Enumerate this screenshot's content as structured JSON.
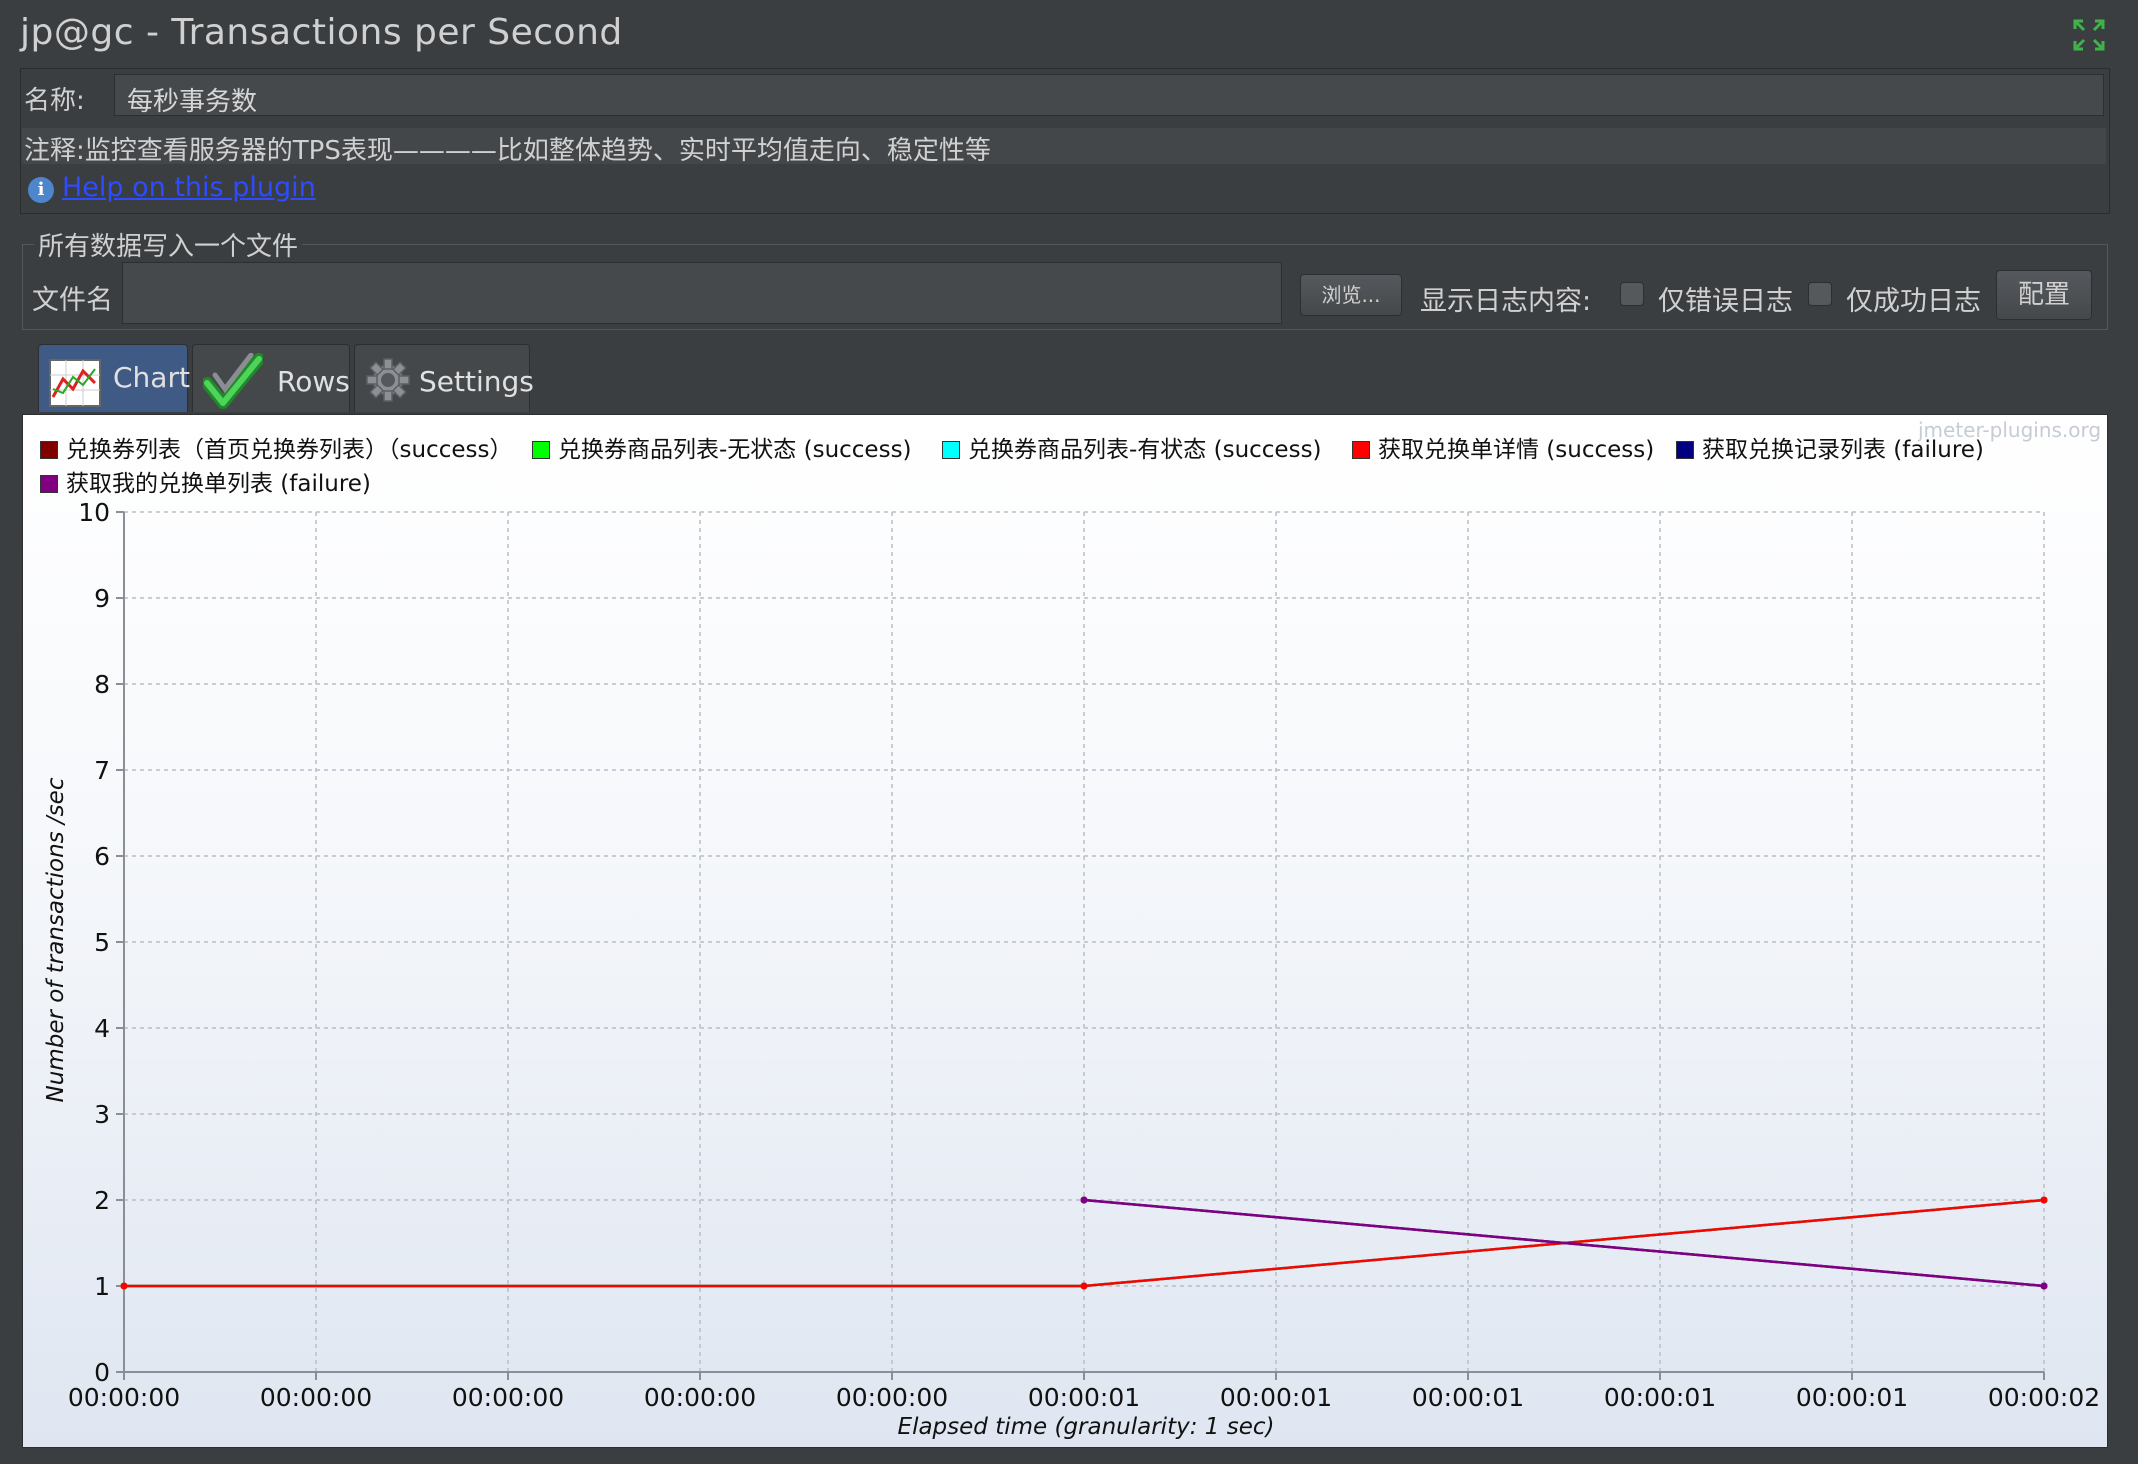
{
  "window": {
    "title": "jp@gc - Transactions per Second"
  },
  "form": {
    "name_label": "名称:",
    "name_value": "每秒事务数",
    "comment_label": "注释:",
    "comment_value": "监控查看服务器的TPS表现————比如整体趋势、实时平均值走向、稳定性等",
    "help_link": "Help on this plugin"
  },
  "file_panel": {
    "legend": "所有数据写入一个文件",
    "file_label": "文件名",
    "file_value": "",
    "browse_button": "浏览...",
    "log_label": "显示日志内容:",
    "errors_only": {
      "label": "仅错误日志",
      "checked": false
    },
    "success_only": {
      "label": "仅成功日志",
      "checked": false
    },
    "config_button": "配置"
  },
  "tabs": [
    {
      "label": "Chart",
      "icon": "chart-icon",
      "active": true
    },
    {
      "label": "Rows",
      "icon": "checkmark-icon",
      "active": false
    },
    {
      "label": "Settings",
      "icon": "gear-icon",
      "active": false
    }
  ],
  "chart": {
    "watermark": "jmeter-plugins.org"
  },
  "chart_data": {
    "type": "line",
    "xlabel": "Elapsed time (granularity: 1 sec)",
    "ylabel": "Number of transactions /sec",
    "ylim": [
      0,
      10
    ],
    "yticks": [
      "0",
      "1",
      "2",
      "3",
      "4",
      "5",
      "6",
      "7",
      "8",
      "9",
      "10"
    ],
    "x_tick_labels": [
      "00:00:00",
      "00:00:00",
      "00:00:00",
      "00:00:00",
      "00:00:00",
      "00:00:01",
      "00:00:01",
      "00:00:01",
      "00:00:01",
      "00:00:01",
      "00:00:02"
    ],
    "grid": true,
    "legend_position": "top",
    "series": [
      {
        "name": "兑换券列表（首页兑换券列表）（success）",
        "color": "#800000",
        "x": [
          0,
          1,
          2
        ],
        "y": [
          1,
          1,
          2
        ]
      },
      {
        "name": "兑换券商品列表-无状态 (success)",
        "color": "#00ff00",
        "x": [
          0,
          1,
          2
        ],
        "y": [
          1,
          1,
          2
        ]
      },
      {
        "name": "兑换券商品列表-有状态 (success)",
        "color": "#00ffff",
        "x": [
          0,
          1,
          2
        ],
        "y": [
          1,
          1,
          2
        ]
      },
      {
        "name": "获取兑换单详情 (success)",
        "color": "#ff0000",
        "x": [
          0,
          1,
          2
        ],
        "y": [
          1,
          1,
          2
        ]
      },
      {
        "name": "获取兑换记录列表 (failure)",
        "color": "#000080",
        "x": [
          1,
          2
        ],
        "y": [
          2,
          1
        ]
      },
      {
        "name": "获取我的兑换单列表 (failure)",
        "color": "#800080",
        "x": [
          1,
          2
        ],
        "y": [
          2,
          1
        ]
      }
    ]
  }
}
